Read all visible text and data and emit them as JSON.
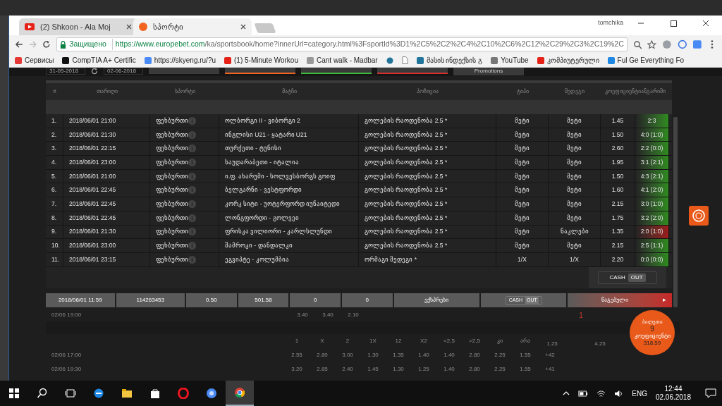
{
  "browser": {
    "tabs": [
      {
        "title": "(2) Shkoon - Ala Moj",
        "selected": false
      },
      {
        "title": "სპორტი",
        "selected": true
      }
    ],
    "user": "tomchika",
    "secure_label": "Защищено",
    "url_host": "https://www.europebet.com",
    "url_path": "/ka/sportsbook/home?innerUrl=category.html%3FsportId%3D1%2C5%2C2%2C4%2C10%2C6%2C12%2C29%2C3%2C19%2C",
    "bookmarks": [
      "Сервисы",
      "CompTIA A+ Certific",
      "https://skyeng.ru/?u",
      "(1) 5-Minute Workou",
      "Cant walk - Madbar",
      "მასის ინდექსის გ",
      "YouTube",
      "კომპიუტერული",
      "Ful Ge Everything Fo"
    ]
  },
  "filters": {
    "date_from": "31-05-2018",
    "date_to": "02-06-2018",
    "promotions": "Promotions"
  },
  "bets": {
    "columns": [
      "#",
      "თარიღი",
      "სპორტი",
      "მატჩი",
      "პოზიცია",
      "ტიპი",
      "შედეგი",
      "კოეფიციენტიანგარიში"
    ],
    "rows": [
      {
        "n": "1.",
        "date": "2018/06/01 21:00",
        "sport": "ფეხბურთი",
        "match": "ოლბორგი II - ვიბორგი 2",
        "position": "გოლების რაოდენობა 2.5 *",
        "type": "მეტი",
        "result": "მეტი",
        "odds": "1.45",
        "score": "2:3",
        "won": true
      },
      {
        "n": "2.",
        "date": "2018/06/01 21:30",
        "sport": "ფეხბურთი",
        "match": "ინგლისი U21 - ყატარი U21",
        "position": "გოლების რაოდენობა 2.5 *",
        "type": "მეტი",
        "result": "მეტი",
        "odds": "1.50",
        "score": "4:0 (1:0)",
        "won": true
      },
      {
        "n": "3.",
        "date": "2018/06/01 22:15",
        "sport": "ფეხბურთი",
        "match": "თურქეთი - ტუნისი",
        "position": "გოლების რაოდენობა 2.5 *",
        "type": "მეტი",
        "result": "მეტი",
        "odds": "2.60",
        "score": "2:2 (0:0)",
        "won": true
      },
      {
        "n": "4.",
        "date": "2018/06/01 23:00",
        "sport": "ფეხბურთი",
        "match": "საუდარაბეთი - იტალია",
        "position": "გოლების რაოდენობა 2.5 *",
        "type": "მეტი",
        "result": "მეტი",
        "odds": "1.95",
        "score": "3:1 (2:1)",
        "won": true
      },
      {
        "n": "5.",
        "date": "2018/06/01 21:00",
        "sport": "ფეხბურთი",
        "match": "ი.ფ. ახარუმი - სოლვესბორგს გოიფ",
        "position": "გოლების რაოდენობა 2.5 *",
        "type": "მეტი",
        "result": "მეტი",
        "odds": "1.50",
        "score": "4:3 (2:1)",
        "won": true
      },
      {
        "n": "6.",
        "date": "2018/06/01 22:45",
        "sport": "ფეხბურთი",
        "match": "ბელგარნი - ვესტფორდი",
        "position": "გოლების რაოდენობა 2.5 *",
        "type": "მეტი",
        "result": "მეტი",
        "odds": "1.60",
        "score": "4:1 (2:0)",
        "won": true
      },
      {
        "n": "7.",
        "date": "2018/06/01 22:45",
        "sport": "ფეხბურთი",
        "match": "კორკ სიტი - უოტერფორდ იუნაიტედი",
        "position": "გოლების რაოდენობა 2.5 *",
        "type": "მეტი",
        "result": "მეტი",
        "odds": "2.15",
        "score": "3:0 (1:0)",
        "won": true
      },
      {
        "n": "8.",
        "date": "2018/06/01 22:45",
        "sport": "ფეხბურთი",
        "match": "ლონგფორდი - გოლვეი",
        "position": "გოლების რაოდენობა 2.5 *",
        "type": "მეტი",
        "result": "მეტი",
        "odds": "1.75",
        "score": "3:2 (2:0)",
        "won": true
      },
      {
        "n": "9.",
        "date": "2018/06/01 21:30",
        "sport": "ფეხბურთი",
        "match": "ფრისკა ვილიორი - კარლსლუნდი",
        "position": "გოლების რაოდენობა 2.5 *",
        "type": "მეტი",
        "result": "ნაკლები",
        "odds": "1.35",
        "score": "2:0 (1:0)",
        "won": false
      },
      {
        "n": "10.",
        "date": "2018/06/01 23:00",
        "sport": "ფეხბურთი",
        "match": "შამროკი - დანდალკი",
        "position": "გოლების რაოდენობა 2.5 *",
        "type": "მეტი",
        "result": "მეტი",
        "odds": "2.15",
        "score": "2:5 (1:1)",
        "won": true
      },
      {
        "n": "11.",
        "date": "2018/06/01 23:15",
        "sport": "ფეხბურთი",
        "match": "ეგვიპტე - კოლუმბია",
        "position": "ორმაგი შედეგი *",
        "type": "1/X",
        "result": "1/X",
        "odds": "2.20",
        "score": "0:0 (0:0)",
        "won": true
      }
    ],
    "cashout": [
      "CASH",
      "OUT"
    ]
  },
  "summary": {
    "cells": [
      "2018/06/01 11:59",
      "114263453",
      "0.50",
      "501.58",
      "0",
      "0",
      "ექსპრესი"
    ],
    "cashout": [
      "CASH",
      "OUT"
    ],
    "status": "წაგებული",
    "arrow": "▸"
  },
  "background": {
    "row_time": "02/06 19:00",
    "row_odds": [
      "3.40",
      "3.40",
      "2.10"
    ],
    "headers": [
      "1",
      "X",
      "2",
      "1X",
      "12",
      "X2",
      "<2,5",
      ">2,5",
      "კი",
      "არა"
    ],
    "rows": [
      {
        "time": "02/06 17:00",
        "odds": [
          "2.55",
          "2.80",
          "3.00",
          "1.30",
          "1.35",
          "1.40",
          "1.40",
          "2.80",
          "2.25",
          "1.55"
        ],
        "more": "+42"
      },
      {
        "time": "02/06 19:30",
        "odds": [
          "3.20",
          "2.85",
          "2.40",
          "1.45",
          "1.30",
          "1.25",
          "1.40",
          "2.80",
          "2.25",
          "1.55"
        ],
        "more": "+41"
      }
    ],
    "count": "1",
    "side_odds": [
      "1.25",
      "4.25"
    ]
  },
  "ticket": {
    "label": "ბილეთი",
    "count": "9",
    "odds_label": "კოეფიციენტი",
    "odds": "318.59"
  },
  "taskbar": {
    "lang": "ENG",
    "time": "12:44",
    "date": "02.06.2018"
  }
}
